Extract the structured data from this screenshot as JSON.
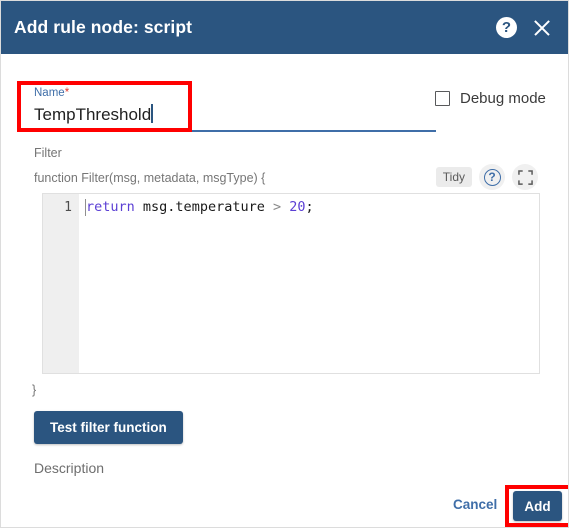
{
  "dialog": {
    "title": "Add rule node: script",
    "help_icon": "question-mark-circle-icon",
    "close_icon": "close-icon"
  },
  "name_field": {
    "label": "Name",
    "required_marker": "*",
    "value": "TempThreshold"
  },
  "debug": {
    "label": "Debug mode",
    "checked": false
  },
  "filter": {
    "section_label": "Filter",
    "signature": "function Filter(msg, metadata, msgType) {",
    "closing_brace": "}"
  },
  "editor_toolbar": {
    "tidy_label": "Tidy",
    "help_label": "?",
    "fullscreen_icon": "fullscreen-expand-icon"
  },
  "editor": {
    "line_number": "1",
    "tokens": {
      "keyword": "return",
      "space1": " ",
      "identifier": "msg.temperature",
      "operator": " > ",
      "number": "20",
      "terminator": ";"
    }
  },
  "buttons": {
    "test_filter": "Test filter function",
    "cancel": "Cancel",
    "add": "Add"
  },
  "description": {
    "label": "Description"
  },
  "colors": {
    "header_blue": "#2b5580",
    "link_blue": "#3f6ea8",
    "required_red": "#e03a2f",
    "annotation_red": "#ff0000",
    "keyword_violet": "#5b3fd4"
  }
}
